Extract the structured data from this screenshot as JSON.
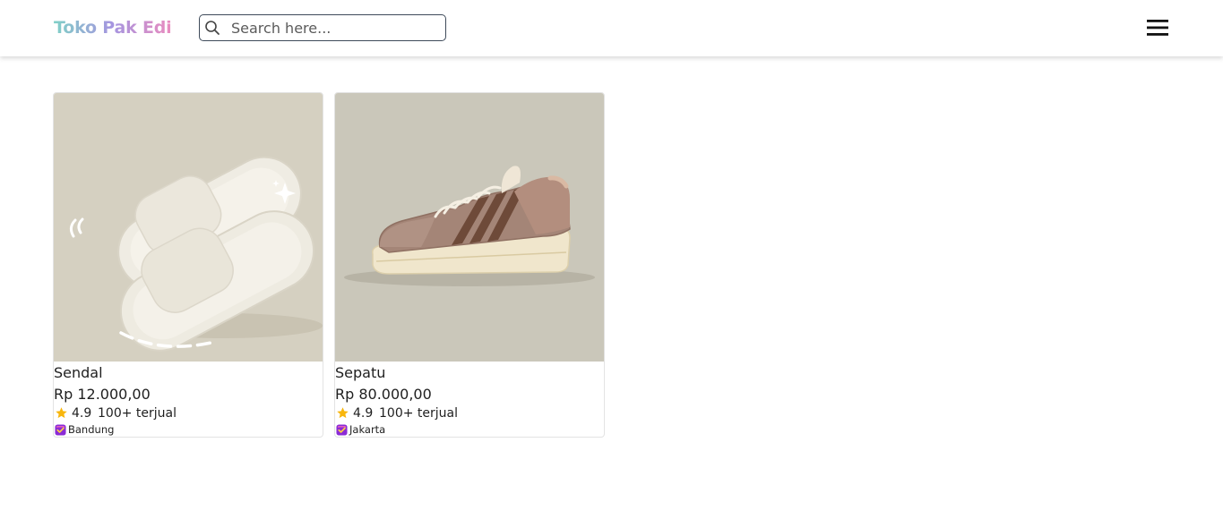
{
  "app": {
    "brand": "Toko Pak Edi",
    "brand_colors": [
      "#80d0c7",
      "#a695e0",
      "#e98cbf"
    ]
  },
  "search": {
    "placeholder": "Search here...",
    "value": "",
    "icon": "search-icon"
  },
  "menu": {
    "icon": "hamburger-menu-icon"
  },
  "products": [
    {
      "name": "Sendal",
      "price": "Rp 12.000,00",
      "rating": "4.9",
      "sold": "100+ terjual",
      "location": "Bandung",
      "image_bg": "#d5d0c1"
    },
    {
      "name": "Sepatu",
      "price": "Rp 80.000,00",
      "rating": "4.9",
      "sold": "100+ terjual",
      "location": "Jakarta",
      "image_bg": "#cac7ba"
    }
  ],
  "colors": {
    "star": "#f8b60d",
    "badge": "#8a2bd6"
  }
}
